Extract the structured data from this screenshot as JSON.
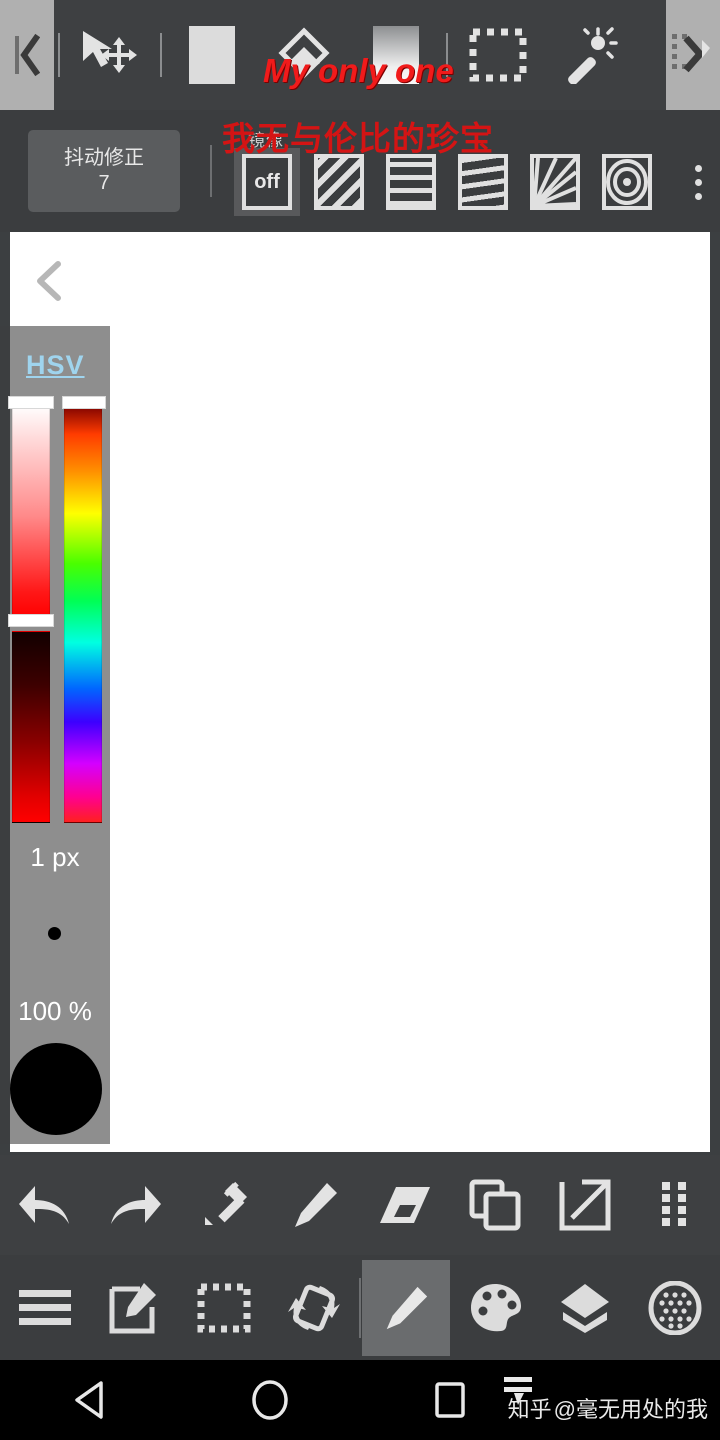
{
  "app": {
    "name": "mobile-paint-app",
    "accent_red": "#f11b1b",
    "accent_dark_red": "#d41414",
    "hsv_label_color": "#9fd4ee",
    "toolbar_bg": "#3e4042",
    "panel_bg": "#8e8e8e",
    "canvas_bg": "#ffffff"
  },
  "toolbar_top": {
    "collapse_left_icon": "chevron-left-icon",
    "collapse_right_icon": "chevron-right-dotted-icon",
    "items": [
      {
        "name": "transform-move-tool",
        "icon": "cursor-move-icon",
        "label": ""
      },
      {
        "name": "fill-solid-tool",
        "icon": "solid-square-icon",
        "label": ""
      },
      {
        "name": "bucket-fill-tool",
        "icon": "paint-bucket-icon",
        "label": ""
      },
      {
        "name": "gradient-tool",
        "icon": "gradient-square-icon",
        "label": ""
      },
      {
        "name": "rect-select-tool",
        "icon": "dotted-rectangle-icon",
        "label": ""
      },
      {
        "name": "magic-wand-tool",
        "icon": "magic-wand-icon",
        "label": ""
      }
    ]
  },
  "toolbar_second": {
    "stabilizer": {
      "label": "抖动修正",
      "value": "7"
    },
    "mirror_label": "镜像",
    "patterns": [
      {
        "name": "guide-off",
        "label": "off",
        "selected": true
      },
      {
        "name": "guide-diagonal",
        "label": "",
        "selected": false
      },
      {
        "name": "guide-grid",
        "label": "",
        "selected": false
      },
      {
        "name": "guide-perspective",
        "label": "",
        "selected": false
      },
      {
        "name": "guide-radial-fan",
        "label": "",
        "selected": false
      },
      {
        "name": "guide-concentric",
        "label": "",
        "selected": false
      }
    ],
    "overflow_icon": "three-dots-vertical-icon"
  },
  "canvas": {
    "back_icon": "chevron-left-icon"
  },
  "color_panel": {
    "mode_label": "HSV",
    "brush_size": "1 px",
    "opacity": "100 %",
    "sliders": [
      {
        "name": "saturation-slider",
        "handle_pos_pct": 0
      },
      {
        "name": "value-slider",
        "handle_pos_pct": 0
      },
      {
        "name": "hue-slider",
        "handle_pos_pct": 0
      }
    ]
  },
  "action_bar": {
    "items": [
      {
        "name": "undo-button",
        "icon": "undo-arrow-icon"
      },
      {
        "name": "redo-button",
        "icon": "redo-arrow-icon"
      },
      {
        "name": "eyedropper-button",
        "icon": "eyedropper-icon"
      },
      {
        "name": "pencil-button",
        "icon": "pencil-icon"
      },
      {
        "name": "eraser-button",
        "icon": "eraser-icon"
      },
      {
        "name": "duplicate-button",
        "icon": "copy-layers-icon"
      },
      {
        "name": "export-button",
        "icon": "share-external-icon"
      },
      {
        "name": "drag-handle",
        "icon": "grid-dots-handle-icon"
      }
    ]
  },
  "nav_bar": {
    "items": [
      {
        "name": "menu-button",
        "icon": "hamburger-menu-icon",
        "active": false
      },
      {
        "name": "edit-canvas-button",
        "icon": "edit-note-icon",
        "active": false
      },
      {
        "name": "select-button",
        "icon": "dotted-select-icon",
        "active": false
      },
      {
        "name": "rotate-button",
        "icon": "rotate-canvas-icon",
        "active": false
      },
      {
        "name": "draw-tool-button",
        "icon": "pencil-icon",
        "active": true
      },
      {
        "name": "palette-button",
        "icon": "palette-icon",
        "active": false
      },
      {
        "name": "layers-button",
        "icon": "layers-icon",
        "active": false
      },
      {
        "name": "texture-button",
        "icon": "texture-dots-icon",
        "active": false
      }
    ]
  },
  "system_bar": {
    "back_icon": "android-back-triangle-icon",
    "home_icon": "android-home-circle-icon",
    "recents_icon": "android-recents-square-icon"
  },
  "watermark": {
    "logo_text": "知乎",
    "handle": "@毫无用处的我"
  },
  "annotations": {
    "english": "My only one",
    "chinese": "我无与伦比的珍宝"
  }
}
